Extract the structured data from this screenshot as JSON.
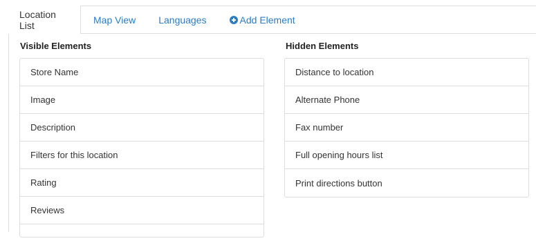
{
  "tabs": [
    {
      "label": "Location List",
      "active": true
    },
    {
      "label": "Map View",
      "active": false
    },
    {
      "label": "Languages",
      "active": false
    },
    {
      "label": "Add Element",
      "active": false,
      "icon": "plus-circle-icon"
    }
  ],
  "visible": {
    "title": "Visible Elements",
    "items": [
      "Store Name",
      "Image",
      "Description",
      "Filters for this location",
      "Rating",
      "Reviews",
      ""
    ]
  },
  "hidden": {
    "title": "Hidden Elements",
    "items": [
      "Distance to location",
      "Alternate Phone",
      "Fax number",
      "Full opening hours list",
      "Print directions button"
    ]
  },
  "colors": {
    "link": "#2e7bbf",
    "border": "#dddddd",
    "text": "#333333"
  }
}
